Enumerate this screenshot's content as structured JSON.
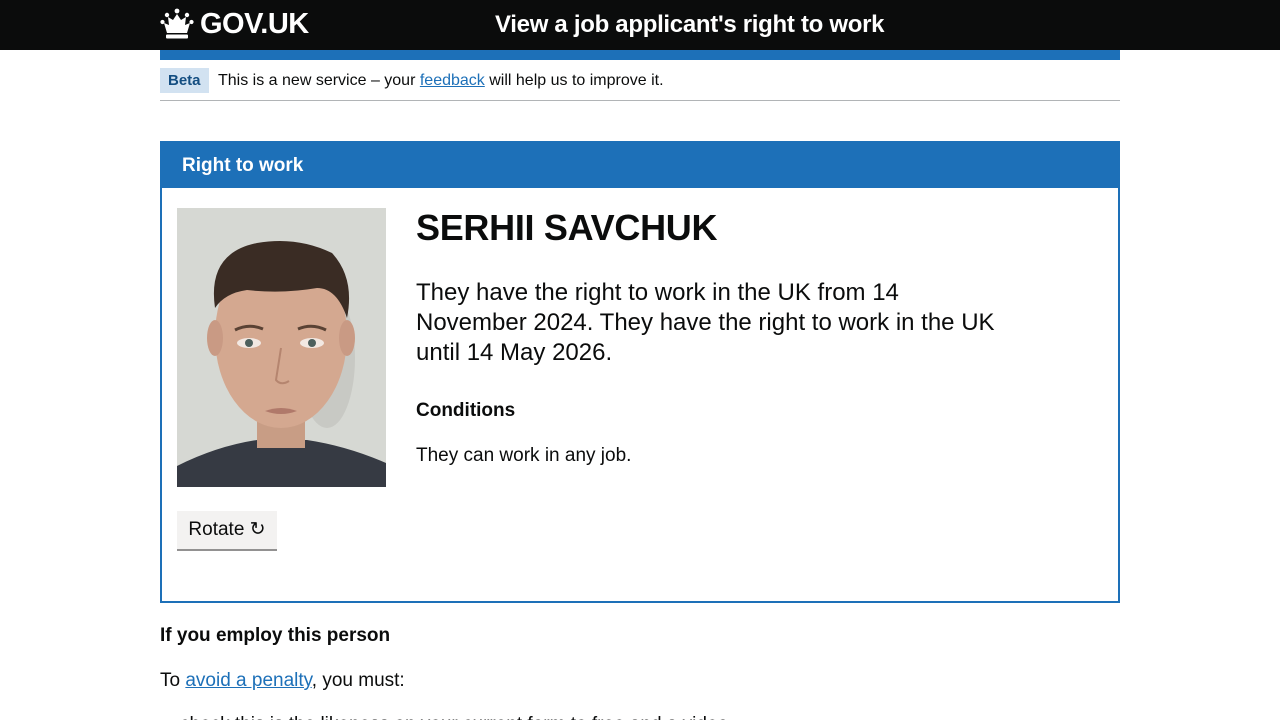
{
  "header": {
    "logo_text": "GOV.UK",
    "service_name": "View a job applicant's right to work"
  },
  "phase_banner": {
    "tag": "Beta",
    "text_before": "This is a new service – your ",
    "link": "feedback",
    "text_after": " will help us to improve it."
  },
  "panel": {
    "title": "Right to work",
    "person_name": "SERHII SAVCHUK",
    "status_text": "They have the right to work in the UK from 14 November 2024. They have the right to work in the UK until 14 May 2026.",
    "conditions_heading": "Conditions",
    "conditions_text": "They can work in any job.",
    "rotate_label": "Rotate ↻"
  },
  "employ": {
    "heading": "If you employ this person",
    "text_before": "To ",
    "link": "avoid a penalty",
    "text_after": ", you must:",
    "partial_line": "check this is the likeness on your current form to free and a video call"
  },
  "colors": {
    "header_bg": "#0b0c0c",
    "brand_blue": "#1d70b8",
    "phase_tag_bg": "#d2e2f1",
    "button_bg": "#f3f2f1"
  }
}
